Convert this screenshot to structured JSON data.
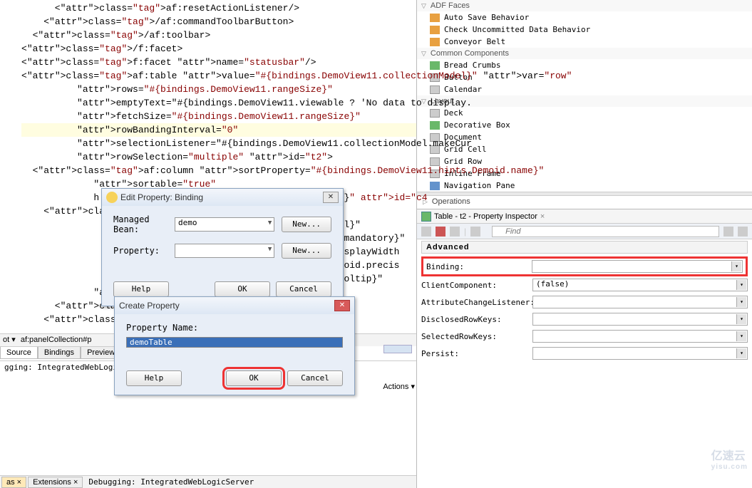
{
  "code": {
    "lines": [
      "      <af:resetActionListener/>",
      "    </af:commandToolbarButton>",
      "  </af:toolbar>",
      "</f:facet>",
      "<f:facet name=\"statusbar\"/>",
      "<af:table value=\"#{bindings.DemoView11.collectionModel}\" var=\"row\"",
      "          rows=\"#{bindings.DemoView11.rangeSize}\"",
      "          emptyText=\"#{bindings.DemoView11.viewable ? 'No data to display.",
      "          fetchSize=\"#{bindings.DemoView11.rangeSize}\"",
      "          rowBandingInterval=\"0\"",
      "          selectionListener=\"#{bindings.DemoView11.collectionModel.makeCur",
      "          rowSelection=\"multiple\" id=\"t2\">",
      "  <af:column sortProperty=\"#{bindings.DemoView11.hints.Demoid.name}\"",
      "             sortable=\"true\"",
      "             h                                           l}\" id=\"c4",
      "    <af:inputTe",
      "                                                          l}\"",
      "                                                          mandatory}\"",
      "                                                          splayWidth",
      "                                                          oid.precis",
      "                                                          oltip}\"",
      "             id=\"it3\"",
      "      <f:validat",
      "    </af:inputTe"
    ],
    "hl_index": 9
  },
  "dialog1": {
    "title": "Edit Property: Binding",
    "managed_bean_lbl": "Managed Bean:",
    "managed_bean_val": "demo",
    "property_lbl": "Property:",
    "property_val": "",
    "new_btn": "New...",
    "help_btn": "Help",
    "ok_btn": "OK",
    "cancel_btn": "Cancel"
  },
  "dialog2": {
    "title": "Create Property",
    "name_lbl": "Property Name:",
    "name_val": "demoTable",
    "help_btn": "Help",
    "ok_btn": "OK",
    "cancel_btn": "Cancel"
  },
  "breadcrumb": [
    "ot ▾",
    "af:panelCollection#p"
  ],
  "bottom_tabs": [
    "Source",
    "Bindings",
    "Preview"
  ],
  "status_text": "gging: IntegratedWebLogicS",
  "actions_label": "Actions ▾",
  "very_bottom": {
    "tab1": "as ×",
    "tab2": "Extensions ×",
    "debug": "Debugging: IntegratedWebLogicServer"
  },
  "palette": {
    "groups": [
      {
        "label": "ADF Faces",
        "items": [
          {
            "ico": "piorange",
            "text": "Auto Save Behavior"
          },
          {
            "ico": "piorange",
            "text": "Check Uncommitted Data Behavior"
          },
          {
            "ico": "piorange",
            "text": "Conveyor Belt"
          }
        ]
      },
      {
        "label": "Common Components",
        "items": [
          {
            "ico": "pigreen",
            "text": "Bread Crumbs"
          },
          {
            "ico": "pigray",
            "text": "Button"
          },
          {
            "ico": "pigray",
            "text": "Calendar"
          }
        ]
      },
      {
        "label": "Layout",
        "items": [
          {
            "ico": "pigray",
            "text": "Deck"
          },
          {
            "ico": "pigreen",
            "text": "Decorative Box"
          },
          {
            "ico": "pigray",
            "text": "Document"
          },
          {
            "ico": "pigray",
            "text": "Grid Cell"
          },
          {
            "ico": "pigray",
            "text": "Grid Row"
          },
          {
            "ico": "pigray",
            "text": "Inline Frame"
          },
          {
            "ico": "piblue",
            "text": "Navigation Pane"
          }
        ]
      }
    ],
    "operations_label": "Operations"
  },
  "inspector": {
    "tab": "Table - t2 - Property Inspector",
    "find_placeholder": "Find",
    "section": "Advanced",
    "props": [
      {
        "lbl": "Binding:",
        "val": "",
        "hl": true
      },
      {
        "lbl": "ClientComponent:",
        "val": "<default> (false)"
      },
      {
        "lbl": "AttributeChangeListener:",
        "val": ""
      },
      {
        "lbl": "DisclosedRowKeys:",
        "val": ""
      },
      {
        "lbl": "SelectedRowKeys:",
        "val": ""
      },
      {
        "lbl": "Persist:",
        "val": ""
      }
    ]
  },
  "watermark": {
    "l1": "亿速云",
    "l2": "yisu.com"
  }
}
